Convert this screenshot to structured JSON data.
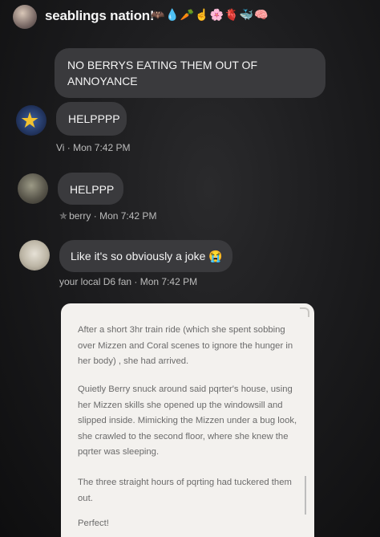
{
  "header": {
    "title": "seablings nation!",
    "emojis": "🦇💧🥕☝🌸🫀🐳🧠"
  },
  "messages": [
    {
      "text": "NO BERRYS EATING THEM OUT OF ANNOYANCE"
    },
    {
      "text": "HELPPPP",
      "author": "Vi",
      "time": "Mon 7:42 PM",
      "meta": "Vi · Mon 7:42 PM"
    },
    {
      "text": "HELPPP",
      "author": "berry",
      "time": "Mon 7:42 PM",
      "meta": "berry · Mon 7:42 PM"
    },
    {
      "text": "Like it's so obviously a joke 😭",
      "author": "your local D6 fan",
      "time": "Mon 7:42 PM",
      "meta": "your local D6 fan · Mon 7:42 PM"
    }
  ],
  "story_card": {
    "paragraphs": [
      "After a short 3hr train ride (which she spent sobbing over Mizzen and Coral scenes to ignore the hunger in her body) , she had arrived.",
      "Quietly Berry snuck around said pqrter's house, using her Mizzen skills she opened up the windowsill and slipped inside. Mimicking the Mizzen under a bug look, she crawled to the second floor, where she knew the pqrter was sleeping.",
      "The three straight hours of pqrting had tuckered them out.",
      "Perfect!"
    ]
  },
  "icons": {
    "vi_avatar": "star-icon",
    "berry_badge": "star-outline-icon"
  },
  "colors": {
    "background": "#1c1c1e",
    "bubble": "#3a3a3d",
    "card": "#f3f1ee",
    "star": "#f2c230"
  }
}
